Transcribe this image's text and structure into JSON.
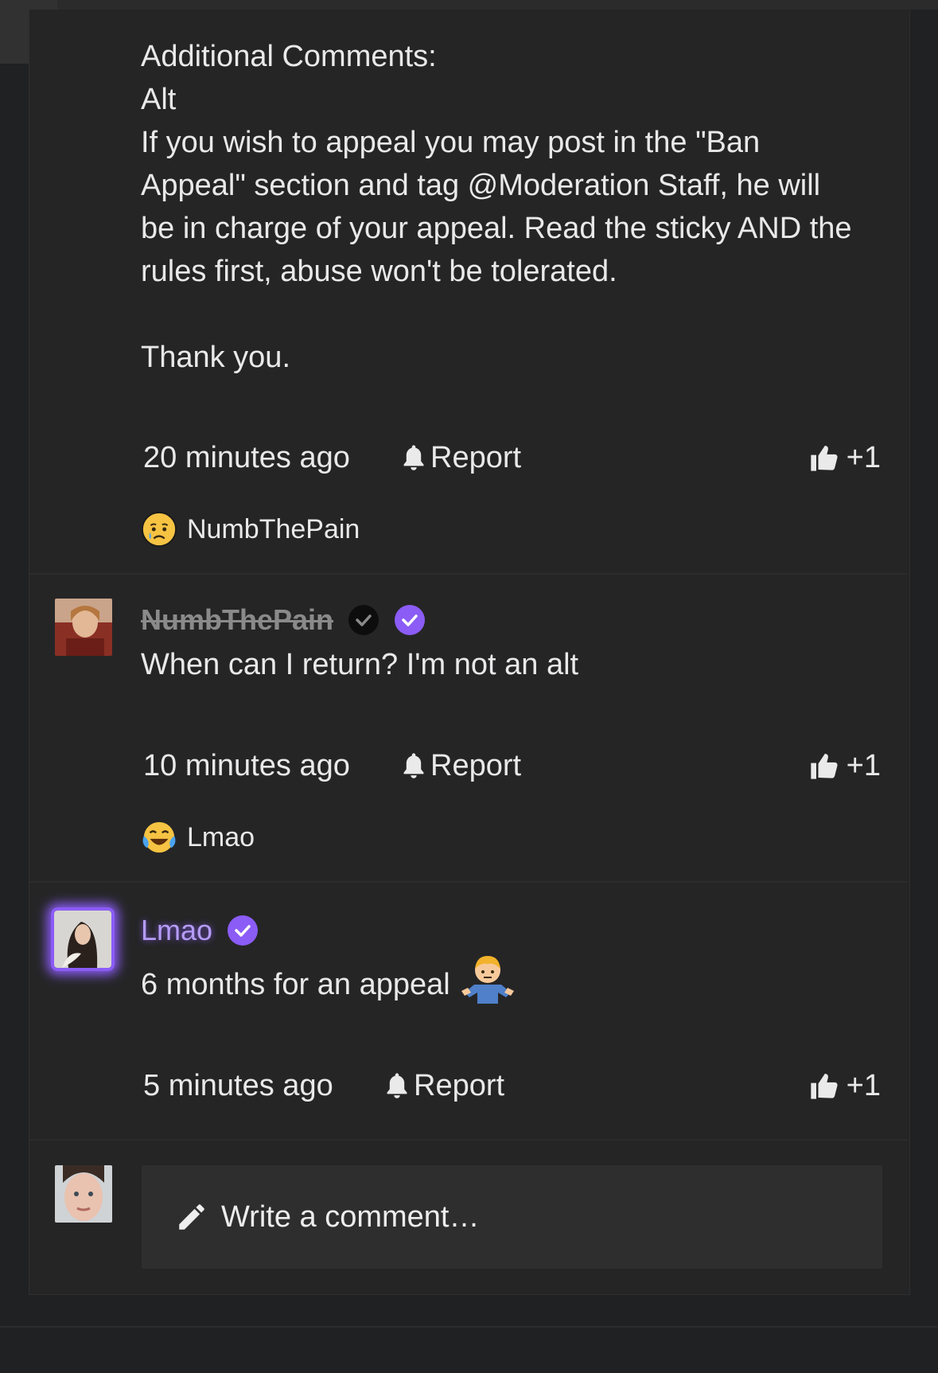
{
  "colors": {
    "background": "#202122",
    "panel": "#252526",
    "accent": "#8b5cf6",
    "text": "#e9e9ea",
    "muted": "#8a8a8b"
  },
  "post": {
    "lines": [
      "Additional Comments:",
      "Alt",
      "If you wish to appeal you may post in the \"Ban",
      "Appeal\" section and tag @Moderation Staff, he will",
      "be in charge of your appeal. Read the sticky AND the",
      "rules first, abuse won't be tolerated.",
      "",
      "Thank you."
    ],
    "time": "20 minutes ago",
    "report_label": "Report",
    "like_label": "+1",
    "reaction": {
      "icon": "crying-face-icon",
      "user": "NumbThePain"
    }
  },
  "comments": [
    {
      "username": "NumbThePain",
      "text": "When can I return? I'm not an alt",
      "time": "10 minutes ago",
      "report_label": "Report",
      "like_label": "+1",
      "reaction": {
        "icon": "laughing-tears-face-icon",
        "user": "Lmao"
      }
    },
    {
      "username": "Lmao",
      "text": "6 months for an appeal",
      "time": "5 minutes ago",
      "report_label": "Report",
      "like_label": "+1"
    }
  ],
  "composer": {
    "placeholder": "Write a comment…",
    "icon": "pencil-icon"
  }
}
